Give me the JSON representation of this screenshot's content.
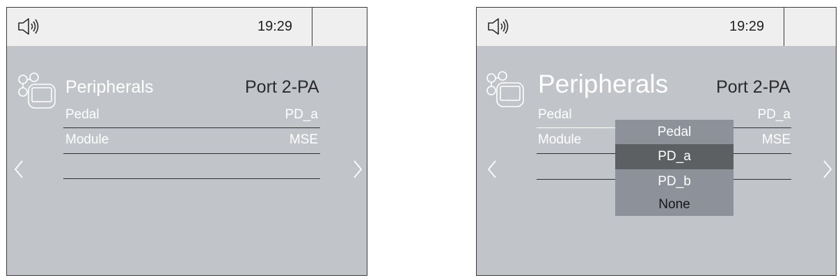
{
  "left_screen": {
    "time": "19:29",
    "title": "Peripherals",
    "port": "Port 2-PA",
    "rows": [
      {
        "label": "Pedal",
        "value": "PD_a"
      },
      {
        "label": "Module",
        "value": "MSE"
      }
    ]
  },
  "right_screen": {
    "time": "19:29",
    "title": "Peripherals",
    "port": "Port 2-PA",
    "rows": [
      {
        "label": "Pedal",
        "value": "PD_a"
      },
      {
        "label": "Module",
        "value": "MSE"
      }
    ],
    "dropdown": {
      "options": [
        "Pedal",
        "PD_a",
        "PD_b",
        "None"
      ],
      "selected": "PD_a"
    }
  },
  "icons": {
    "speaker": "speaker-icon",
    "peripherals": "peripherals-icon",
    "prev": "chevron-left-icon",
    "next": "chevron-right-icon"
  },
  "colors": {
    "screen_bg": "#c1c5c9",
    "topbar_bg": "#efefef",
    "dropdown_bg": "#8d9199",
    "dropdown_selected_bg": "#5d6062"
  }
}
